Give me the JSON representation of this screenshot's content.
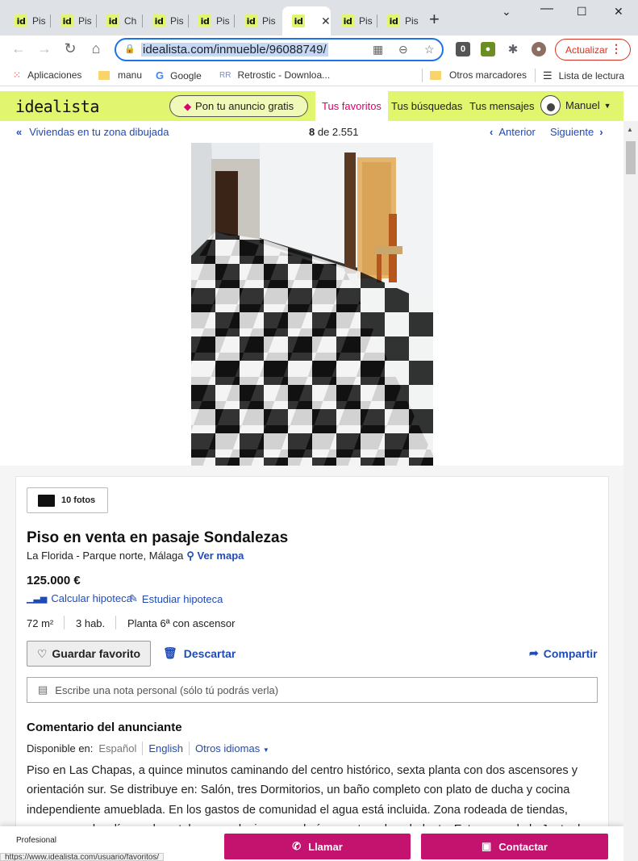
{
  "browser": {
    "tabs": [
      {
        "label": "Pis",
        "active": false
      },
      {
        "label": "Pis",
        "active": false
      },
      {
        "label": "Ch",
        "active": false
      },
      {
        "label": "Pis",
        "active": false
      },
      {
        "label": "Pis",
        "active": false
      },
      {
        "label": "Pis",
        "active": false
      },
      {
        "label": "",
        "active": true
      },
      {
        "label": "Pis",
        "active": false
      },
      {
        "label": "Pis",
        "active": false
      }
    ],
    "favicon_text": "id",
    "url": "idealista.com/inmueble/96088749/",
    "update_label": "Actualizar",
    "bookmarks": {
      "apps": "Aplicaciones",
      "manu": "manu",
      "google": "Google",
      "retrostic": "Retrostic - Downloa...",
      "others": "Otros marcadores",
      "reading_list": "Lista de lectura"
    }
  },
  "site": {
    "logo": "idealista",
    "post_ad": "Pon tu anuncio gratis",
    "nav": {
      "favorites": "Tus favoritos",
      "searches": "Tus búsquedas",
      "messages": "Tus mensajes",
      "user": "Manuel"
    },
    "subnav": {
      "back": "Viviendas en tu zona dibujada",
      "position": "8",
      "of": "de 2.551",
      "prev": "Anterior",
      "next": "Siguiente"
    }
  },
  "listing": {
    "photos_label": "10 fotos",
    "title": "Piso en venta en pasaje Sondalezas",
    "location": "La Florida - Parque norte, Málaga",
    "map_link": "Ver mapa",
    "price": "125.000 €",
    "calc_mortgage": "Calcular hipoteca",
    "study_mortgage": "Estudiar hipoteca",
    "features": [
      "72 m²",
      "3 hab.",
      "Planta 6ª con ascensor"
    ],
    "save_favorite": "Guardar favorito",
    "discard": "Descartar",
    "share": "Compartir",
    "note_placeholder": "Escribe una nota personal (sólo tú podrás verla)",
    "comment_title": "Comentario del anunciante",
    "available_in": "Disponible en:",
    "languages": [
      "Español",
      "English",
      "Otros idiomas"
    ],
    "description": "Piso en Las Chapas, a quince minutos caminando del centro histórico, sexta planta con dos ascensores y orientación sur. Se distribuye en: Salón, tres Dormitorios, un baño completo con plato de ducha y cocina independiente amueblada. En los gastos de comunidad el agua está incluida. Zona rodeada de tiendas, supermercados, líneas de autobuses, colegios, guarderías, centros de salud, etc. Esta cerca de la Junta de Andalucía."
  },
  "contact_bar": {
    "professional": "Profesional",
    "call": "Llamar",
    "contact": "Contactar"
  },
  "status_url": "https://www.idealista.com/usuario/favoritos/",
  "colors": {
    "brand_yellow": "#e1f56e",
    "brand_pink": "#c4126f",
    "link_blue": "#1f4bb8"
  }
}
